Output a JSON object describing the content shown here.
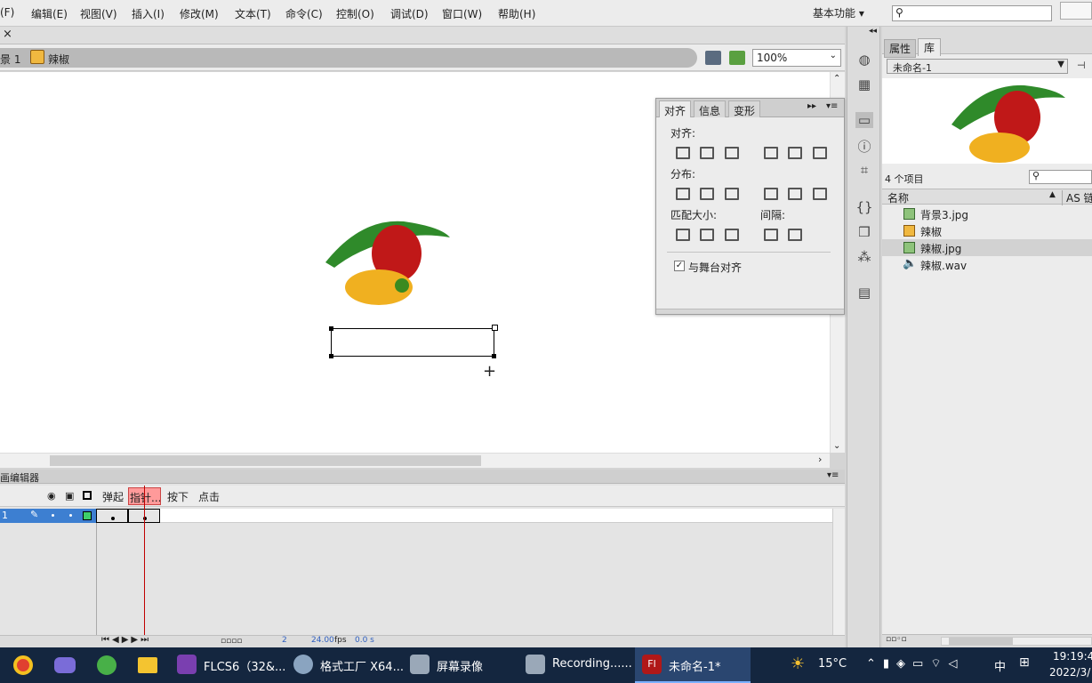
{
  "menubar": {
    "items": [
      "(F)",
      "编辑(E)",
      "视图(V)",
      "插入(I)",
      "修改(M)",
      "文本(T)",
      "命令(C)",
      "控制(O)",
      "调试(D)",
      "窗口(W)",
      "帮助(H)"
    ],
    "workspace": "基本功能"
  },
  "doc": {
    "close": "×",
    "scene": "景 1",
    "symbol": "辣椒",
    "zoom": "100%"
  },
  "timeline": {
    "title": "画编辑器",
    "frames": {
      "up": "弹起",
      "over": "指针...",
      "down": "按下",
      "hit": "点击"
    },
    "layer": "1",
    "current_frame": "2",
    "fps": "24.00",
    "fps_unit": "fps",
    "time": "0.0 s"
  },
  "align": {
    "tabs": [
      "对齐",
      "信息",
      "变形"
    ],
    "align_label": "对齐:",
    "distribute_label": "分布:",
    "match_label": "匹配大小:",
    "space_label": "间隔:",
    "stage_label": "与舞台对齐"
  },
  "library": {
    "tabs": [
      "属性",
      "库"
    ],
    "doc": "未命名-1",
    "count": "4 个项目",
    "col_name": "名称",
    "col_as": "AS 链",
    "items": [
      {
        "name": "背景3.jpg",
        "icon": "bitmap-icon"
      },
      {
        "name": "辣椒",
        "icon": "button-symbol-icon"
      },
      {
        "name": "辣椒.jpg",
        "icon": "bitmap-icon"
      },
      {
        "name": "辣椒.wav",
        "icon": "sound-icon"
      }
    ]
  },
  "taskbar": {
    "items": [
      "FLCS6（32&...",
      "格式工厂 X64...",
      "屏幕录像",
      "Recording......",
      "未命名-1*"
    ],
    "weather": "15°C",
    "ime": "中",
    "time": "19:19:45",
    "date": "2022/3/"
  }
}
